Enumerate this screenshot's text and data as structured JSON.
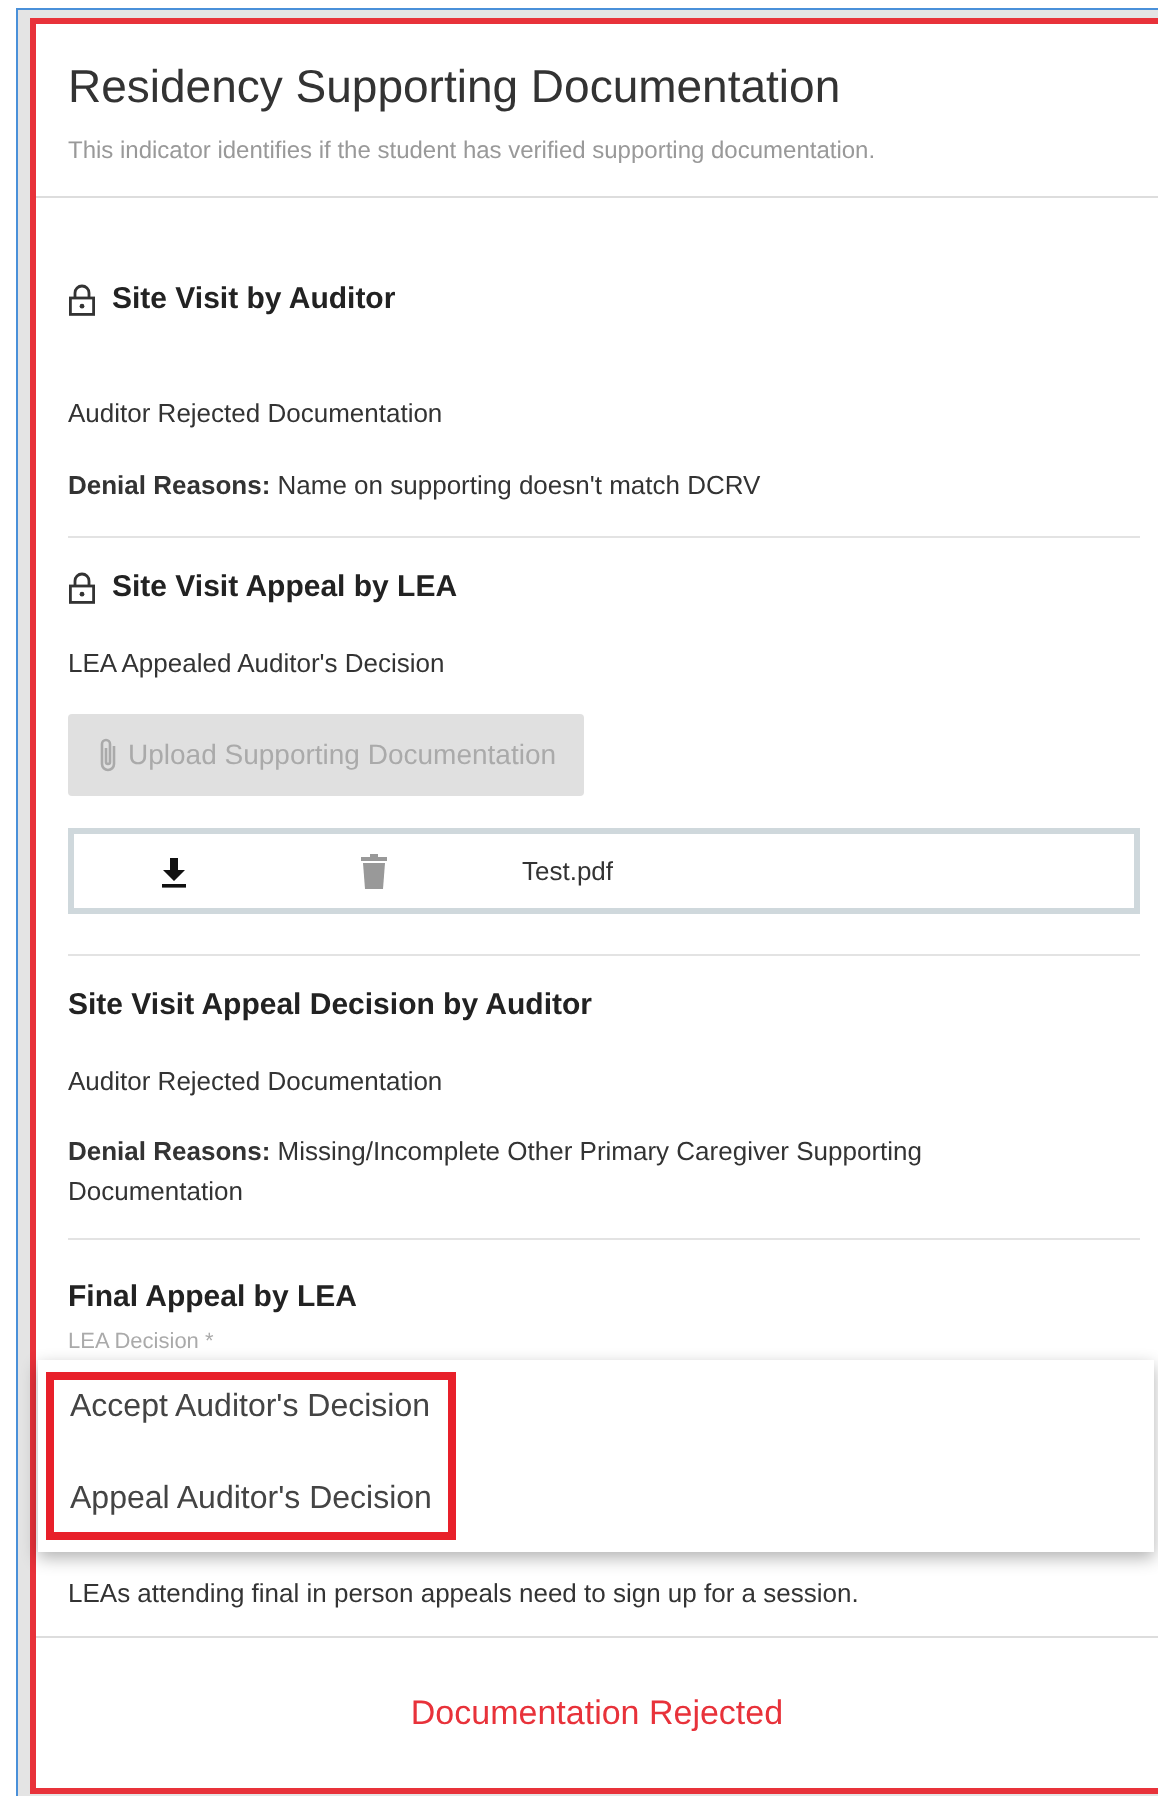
{
  "title": "Residency Supporting Documentation",
  "subtitle": "This indicator identifies if the student has verified supporting documentation.",
  "sections": [
    {
      "kind": "review",
      "heading": "Site Visit by Auditor",
      "locked": true,
      "status": "Auditor Rejected Documentation",
      "denial": "**Denial Reasons:** Name on supporting doesn't match DCRV"
    },
    {
      "kind": "upload",
      "heading": "Site Visit Appeal by LEA",
      "locked": true,
      "status": "LEA Appealed Auditor's Decision",
      "upload_button": {
        "label": "Upload Supporting Documentation",
        "disabled": true
      },
      "files": [
        {
          "name": "Test.pdf",
          "delete_disabled": true
        }
      ]
    },
    {
      "kind": "review",
      "heading": "Site Visit Appeal Decision by Auditor",
      "locked": false,
      "status": "Auditor Rejected Documentation",
      "denial": "**Denial Reasons:** Missing/Incomplete Other Primary Caregiver Supporting Documentation"
    },
    {
      "kind": "decision",
      "heading": "Final Appeal by LEA",
      "locked": false,
      "field": {
        "label": "LEA Decision *",
        "expanded": true,
        "options_highlighted": true,
        "options": [
          "Accept Auditor's Decision",
          "Appeal Auditor's Decision"
        ]
      },
      "note": "LEAs attending final in person appeals need to sign up for a session."
    }
  ],
  "footer": {
    "text": "Documentation Rejected",
    "is_error": true
  }
}
